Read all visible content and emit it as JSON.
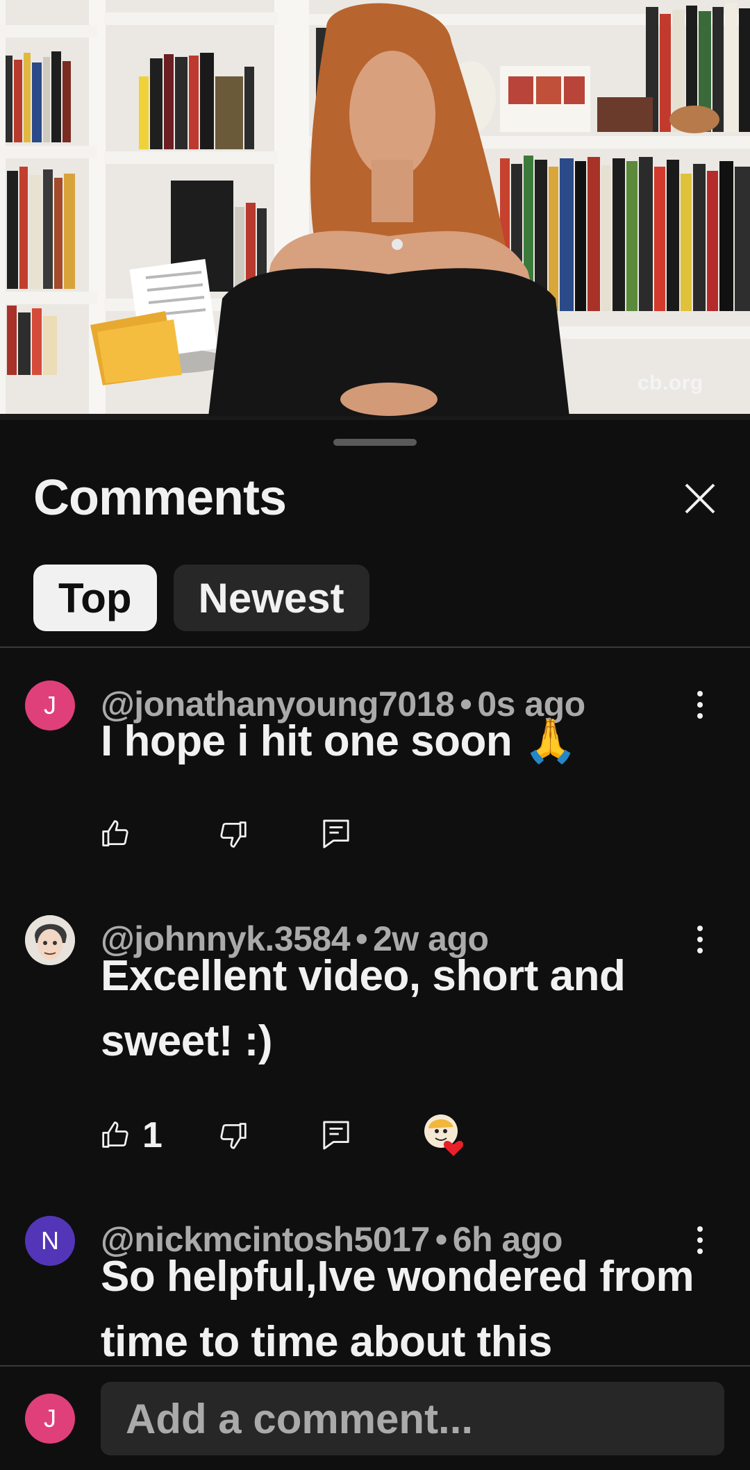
{
  "video": {
    "watermark": "cb.org"
  },
  "comments_panel": {
    "title": "Comments",
    "tabs": [
      {
        "label": "Top",
        "active": true
      },
      {
        "label": "Newest",
        "active": false
      }
    ],
    "comments": [
      {
        "avatar_letter": "J",
        "avatar_color": "#e0407a",
        "handle": "@jonathanyoung7018",
        "time": "0s ago",
        "text": "I hope i hit one soon 🙏",
        "likes": ""
      },
      {
        "avatar_letter": "",
        "avatar_icon": "cartoon-face-avatar",
        "handle": "@johnnyk.3584",
        "time": "2w ago",
        "text": "Excellent video, short and sweet! :)",
        "likes": "1",
        "creator_hearted": true
      },
      {
        "avatar_letter": "N",
        "avatar_color": "#5236b7",
        "handle": "@nickmcintosh5017",
        "time": "6h ago",
        "text": "So helpful,Ive wondered from time to time about this"
      }
    ],
    "input": {
      "avatar_letter": "J",
      "placeholder": "Add a comment..."
    }
  },
  "colors": {
    "background": "#0f0f0f",
    "chip_active": "#f1f1f1",
    "chip_inactive": "#272727",
    "secondary_text": "#aaaaaa"
  }
}
